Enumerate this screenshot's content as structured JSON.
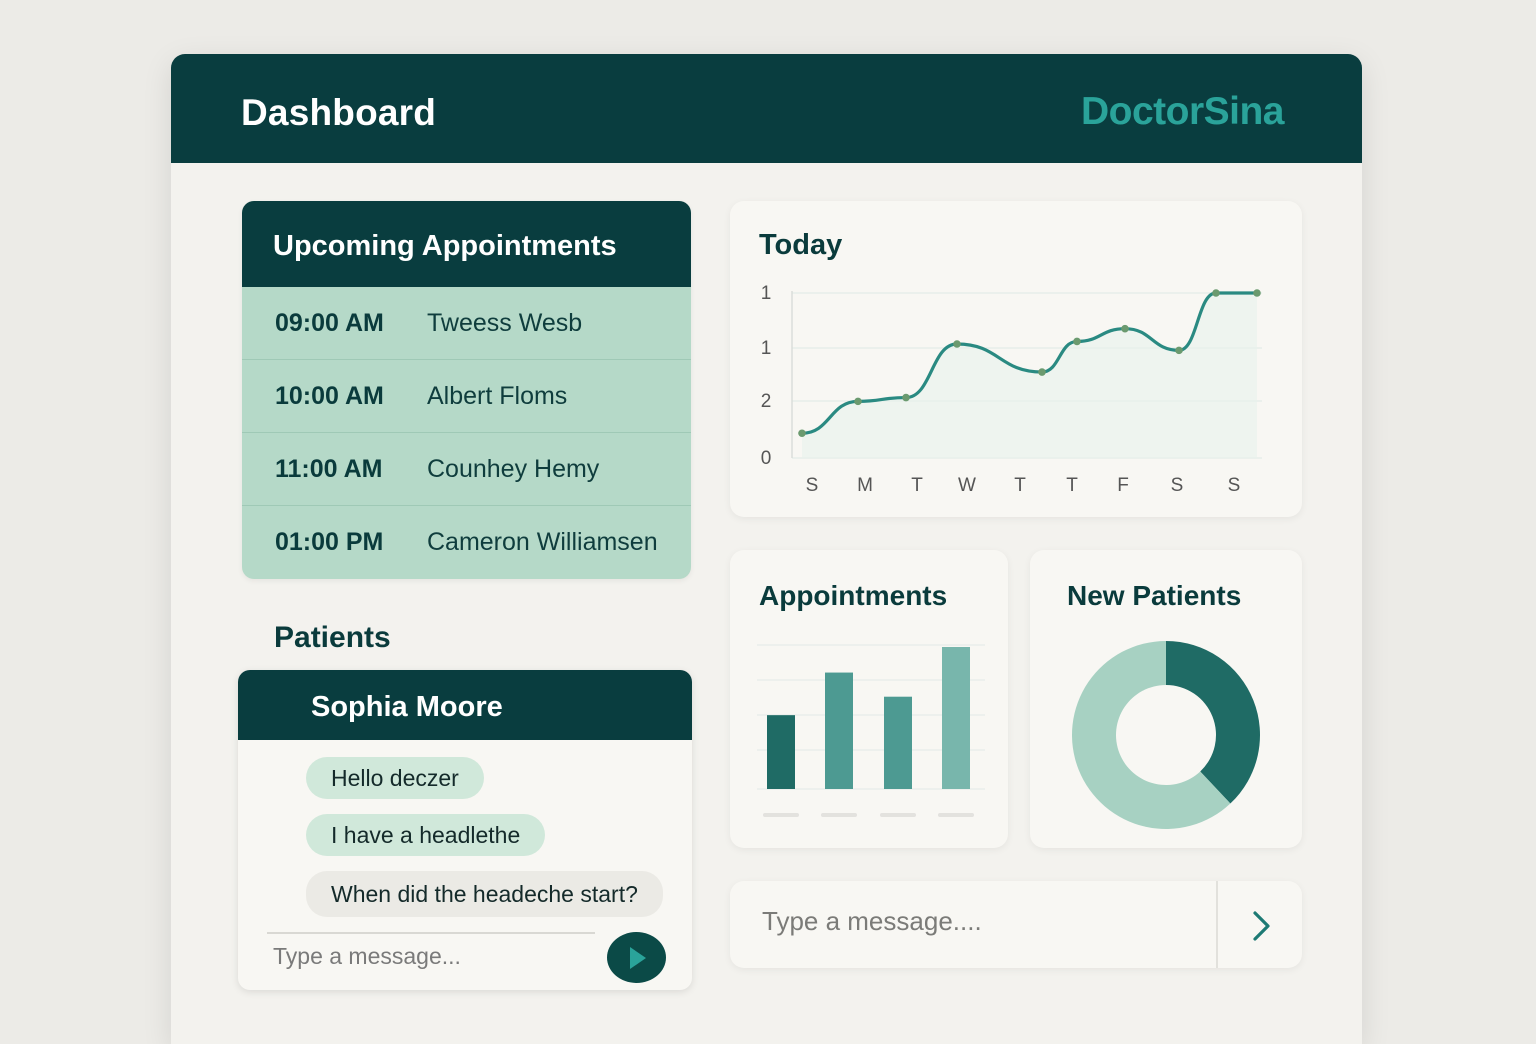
{
  "header": {
    "title": "Dashboard",
    "brand": "DoctorSina"
  },
  "appointments": {
    "title": "Upcoming Appointments",
    "items": [
      {
        "time": "09:00 AM",
        "name": "Tweess Wesb"
      },
      {
        "time": "10:00 AM",
        "name": "Albert Floms"
      },
      {
        "time": "11:00 AM",
        "name": "Counhey Hemy"
      },
      {
        "time": "01:00 PM",
        "name": "Cameron Williamsen"
      }
    ]
  },
  "patients": {
    "section_label": "Patients",
    "chat": {
      "name": "Sophia Moore",
      "messages": [
        "Hello deczer",
        "I have a headlethe",
        "When did the headeche start?"
      ],
      "placeholder": "Type a message..."
    }
  },
  "today": {
    "title": "Today"
  },
  "appointments_chart": {
    "title": "Appointments"
  },
  "new_patients": {
    "title": "New Patients"
  },
  "message_bar": {
    "placeholder": "Type a message...."
  },
  "colors": {
    "dark_teal": "#093d3f",
    "brand_teal": "#2aa39a",
    "line": "#2a8a82",
    "mint": "#b5d9c8"
  },
  "chart_data": [
    {
      "type": "line",
      "title": "Today",
      "categories": [
        "S",
        "M",
        "T",
        "W",
        "T",
        "T",
        "F",
        "S",
        "S"
      ],
      "y_tick_labels": [
        "0",
        "2",
        "1",
        "1"
      ],
      "values": [
        0.1,
        0.35,
        0.38,
        0.8,
        0.58,
        0.82,
        0.92,
        0.75,
        1.2,
        1.2
      ]
    },
    {
      "type": "bar",
      "title": "Appointments",
      "values": [
        0.52,
        0.82,
        0.65,
        1.0
      ]
    },
    {
      "type": "pie",
      "title": "New Patients",
      "values": [
        38,
        62
      ]
    }
  ]
}
